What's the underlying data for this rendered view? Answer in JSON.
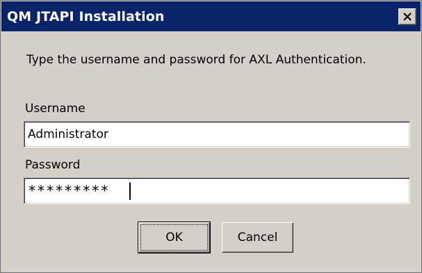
{
  "window": {
    "title": "QM JTAPI Installation",
    "close_icon": "close-x-icon"
  },
  "instruction": "Type the username and password for AXL Authentication.",
  "username": {
    "label": "Username",
    "value": "Administrator"
  },
  "password": {
    "label": "Password",
    "masked_value": "*********"
  },
  "buttons": {
    "ok_label": "OK",
    "cancel_label": "Cancel"
  },
  "colors": {
    "titlebar": "#0a246a",
    "dialog_bg": "#d4d0c8",
    "field_bg": "#ffffff"
  }
}
